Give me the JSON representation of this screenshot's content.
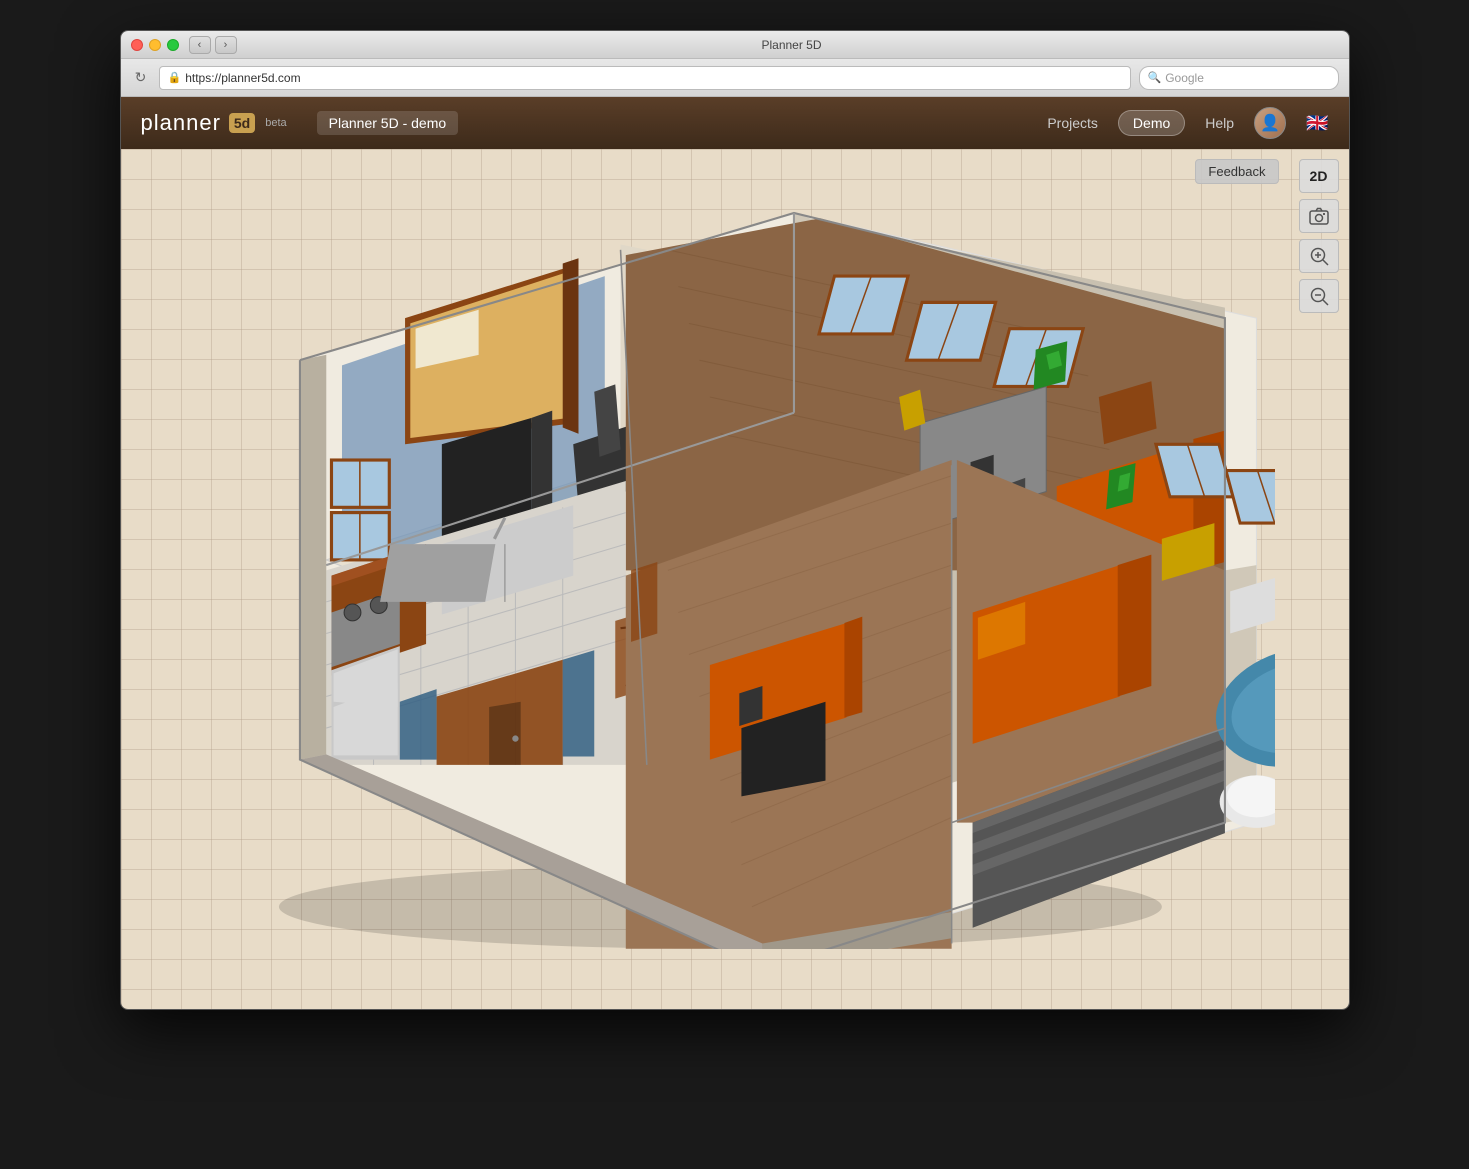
{
  "window": {
    "title": "Planner 5D",
    "title_bar_label": "Planner 5D"
  },
  "browser": {
    "url": "https://planner5d.com",
    "search_placeholder": "Google",
    "back_label": "‹",
    "forward_label": "›",
    "reload_label": "↻"
  },
  "header": {
    "logo_text": "planner",
    "logo_box": "5d",
    "beta_label": "beta",
    "project_name": "Planner 5D - demo",
    "nav": {
      "projects": "Projects",
      "demo": "Demo",
      "help": "Help"
    }
  },
  "toolbar": {
    "feedback_label": "Feedback",
    "view_2d": "2D",
    "screenshot_icon": "📷",
    "zoom_in_icon": "⊕",
    "zoom_out_icon": "⊖"
  },
  "canvas": {
    "background_color": "#e8dcc8",
    "grid_color": "#c8b89a"
  }
}
